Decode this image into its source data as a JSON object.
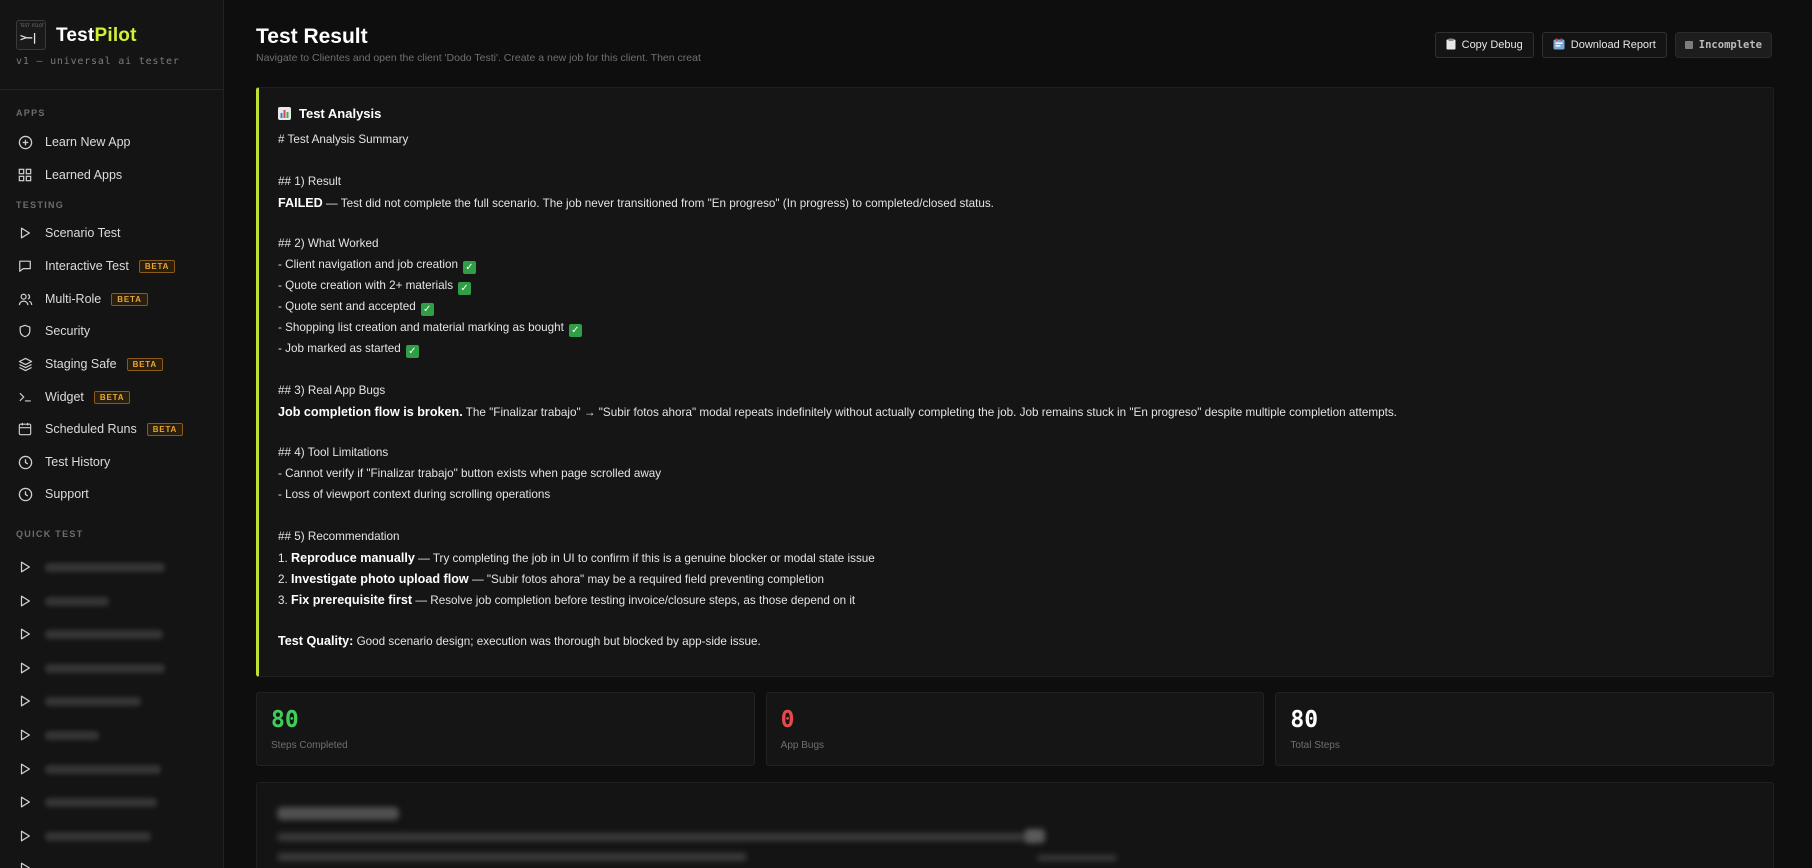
{
  "brand": {
    "logo_tiny": "TEST PILOT",
    "logo_prompt": ">—|",
    "name_part1": "Test",
    "name_part2": "Pilot",
    "tagline": "v1 — universal ai tester"
  },
  "sidebar": {
    "sections": {
      "apps": "APPS",
      "testing": "TESTING",
      "quick_test": "QUICK TEST"
    },
    "apps": [
      {
        "label": "Learn New App",
        "icon": "plus-circle-icon"
      },
      {
        "label": "Learned Apps",
        "icon": "grid-icon"
      }
    ],
    "testing": [
      {
        "label": "Scenario Test",
        "icon": "play-icon",
        "badge": ""
      },
      {
        "label": "Interactive Test",
        "icon": "chat-icon",
        "badge": "BETA"
      },
      {
        "label": "Multi-Role",
        "icon": "users-icon",
        "badge": "BETA"
      },
      {
        "label": "Security",
        "icon": "shield-icon",
        "badge": ""
      },
      {
        "label": "Staging Safe",
        "icon": "layers-icon",
        "badge": "BETA"
      },
      {
        "label": "Widget",
        "icon": "terminal-icon",
        "badge": "BETA"
      },
      {
        "label": "Scheduled Runs",
        "icon": "calendar-icon",
        "badge": "BETA"
      },
      {
        "label": "Test History",
        "icon": "clock-icon",
        "badge": ""
      },
      {
        "label": "Support",
        "icon": "help-icon",
        "badge": ""
      }
    ]
  },
  "header": {
    "title": "Test Result",
    "subtitle": "Navigate to Clientes and open the client 'Dodo Testi'. Create a new job for this client. Then creat",
    "copy_debug": "Copy Debug",
    "download_report": "Download Report",
    "status": "Incomplete"
  },
  "analysis": {
    "heading": "Test Analysis",
    "summary_title": "# Test Analysis Summary",
    "s1_title": "## 1) Result",
    "s1_bold": "FAILED",
    "s1_text": " — Test did not complete the full scenario. The job never transitioned from \"En progreso\" (In progress) to completed/closed status.",
    "s2_title": "## 2) What Worked",
    "s2_items": [
      "- Client navigation and job creation",
      "- Quote creation with 2+ materials",
      "- Quote sent and accepted",
      "- Shopping list creation and material marking as bought",
      "- Job marked as started"
    ],
    "s3_title": "## 3) Real App Bugs",
    "s3_bold": "Job completion flow is broken.",
    "s3_text": " The \"Finalizar trabajo\" → \"Subir fotos ahora\" modal repeats indefinitely without actually completing the job. Job remains stuck in \"En progreso\" despite multiple completion attempts.",
    "s4_title": "## 4) Tool Limitations",
    "s4_items": [
      "- Cannot verify if \"Finalizar trabajo\" button exists when page scrolled away",
      "- Loss of viewport context during scrolling operations"
    ],
    "s5_title": "## 5) Recommendation",
    "s5_items": [
      {
        "num": "1. ",
        "bold": "Reproduce manually",
        "text": " — Try completing the job in UI to confirm if this is a genuine blocker or modal state issue"
      },
      {
        "num": "2. ",
        "bold": "Investigate photo upload flow",
        "text": " — \"Subir fotos ahora\" may be a required field preventing completion"
      },
      {
        "num": "3. ",
        "bold": "Fix prerequisite first",
        "text": " — Resolve job completion before testing invoice/closure steps, as those depend on it"
      }
    ],
    "quality_bold": "Test Quality:",
    "quality_text": " Good scenario design; execution was thorough but blocked by app-side issue."
  },
  "stats": [
    {
      "value": "80",
      "label": "Steps Completed",
      "color": "#3ecf5a"
    },
    {
      "value": "0",
      "label": "App Bugs",
      "color": "#e5484d"
    },
    {
      "value": "80",
      "label": "Total Steps",
      "color": "#ffffff"
    }
  ],
  "colors": {
    "accent": "#d4f036",
    "left_border": "#bde036",
    "beta": "#e8a635"
  }
}
